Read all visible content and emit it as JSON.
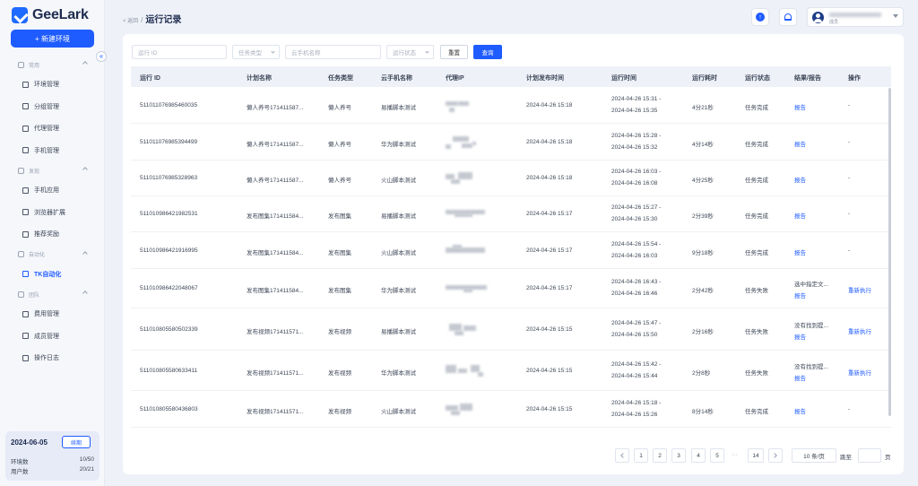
{
  "app": {
    "name": "GeeLark",
    "new_env_label": "+ 新建环境",
    "collapse_glyph": "«"
  },
  "sidebar": {
    "groups": [
      {
        "label": "常用",
        "items": [
          "环境管理",
          "分组管理",
          "代理管理",
          "手机管理"
        ]
      },
      {
        "label": "发现",
        "items": [
          "手机应用",
          "浏览器扩展",
          "推荐奖励"
        ]
      },
      {
        "label": "自动化",
        "items": [
          "TK自动化"
        ]
      },
      {
        "label": "团队",
        "items": [
          "费用管理",
          "成员管理",
          "操作日志"
        ]
      }
    ],
    "active_item": "TK自动化"
  },
  "subscription": {
    "date": "2024-06-05",
    "renew_label": "续期",
    "env_label": "环境数",
    "env_value": "10/50",
    "user_label": "用户数",
    "user_value": "20/21"
  },
  "header": {
    "back_label": "< 返回",
    "separator": "/",
    "title": "运行记录",
    "user_role": "成员"
  },
  "filters": {
    "run_id_placeholder": "运行 ID",
    "task_type_placeholder": "任务类型",
    "phone_name_placeholder": "云手机名称",
    "status_placeholder": "运行状态",
    "reset_label": "重置",
    "query_label": "查询"
  },
  "table": {
    "columns": [
      "运行 ID",
      "计划名称",
      "任务类型",
      "云手机名称",
      "代理IP",
      "计划发布时间",
      "运行时间",
      "运行耗时",
      "运行状态",
      "结果/报告",
      "操作"
    ],
    "rows": [
      {
        "id": "511011076985460035",
        "plan": "懒人养号171411587...",
        "type": "懒人养号",
        "phone": "易播脚本测试",
        "publish": "2024-04-26 15:18",
        "run_start": "2024-04-26 15:31 -",
        "run_end": "2024-04-26 15:35",
        "duration": "4分21秒",
        "status": "任务完成",
        "result": "",
        "report": "报告",
        "action": "-"
      },
      {
        "id": "511011076985394499",
        "plan": "懒人养号171411587...",
        "type": "懒人养号",
        "phone": "华为脚本测试",
        "publish": "2024-04-26 15:18",
        "run_start": "2024-04-26 15:28 -",
        "run_end": "2024-04-26 15:32",
        "duration": "4分14秒",
        "status": "任务完成",
        "result": "",
        "report": "报告",
        "action": "-"
      },
      {
        "id": "511011076985328963",
        "plan": "懒人养号171411587...",
        "type": "懒人养号",
        "phone": "火山脚本测试",
        "publish": "2024-04-26 15:18",
        "run_start": "2024-04-26 16:03 -",
        "run_end": "2024-04-26 16:08",
        "duration": "4分25秒",
        "status": "任务完成",
        "result": "",
        "report": "报告",
        "action": "-"
      },
      {
        "id": "511010986421982531",
        "plan": "发布图集171411584...",
        "type": "发布图集",
        "phone": "易播脚本测试",
        "publish": "2024-04-26 15:17",
        "run_start": "2024-04-26 15:27 -",
        "run_end": "2024-04-26 15:30",
        "duration": "2分39秒",
        "status": "任务完成",
        "result": "",
        "report": "报告",
        "action": "-"
      },
      {
        "id": "511010986421916995",
        "plan": "发布图集171411584...",
        "type": "发布图集",
        "phone": "火山脚本测试",
        "publish": "2024-04-26 15:17",
        "run_start": "2024-04-26 15:54 -",
        "run_end": "2024-04-26 16:03",
        "duration": "9分18秒",
        "status": "任务完成",
        "result": "",
        "report": "报告",
        "action": "-"
      },
      {
        "id": "511010986422048067",
        "plan": "发布图集171411584...",
        "type": "发布图集",
        "phone": "华为脚本测试",
        "publish": "2024-04-26 15:17",
        "run_start": "2024-04-26 16:43 -",
        "run_end": "2024-04-26 16:46",
        "duration": "2分42秒",
        "status": "任务失败",
        "result": "选中指定文...",
        "report": "报告",
        "action": "重新执行"
      },
      {
        "id": "511010805580502339",
        "plan": "发布视频171411571...",
        "type": "发布视频",
        "phone": "易播脚本测试",
        "publish": "2024-04-26 15:15",
        "run_start": "2024-04-26 15:47 -",
        "run_end": "2024-04-26 15:50",
        "duration": "2分16秒",
        "status": "任务失败",
        "result": "没有找到提...",
        "report": "报告",
        "action": "重新执行"
      },
      {
        "id": "511010805580633411",
        "plan": "发布视频171411571...",
        "type": "发布视频",
        "phone": "华为脚本测试",
        "publish": "2024-04-26 15:15",
        "run_start": "2024-04-26 15:42 -",
        "run_end": "2024-04-26 15:44",
        "duration": "2分8秒",
        "status": "任务失败",
        "result": "没有找到提...",
        "report": "报告",
        "action": "重新执行"
      },
      {
        "id": "511010805580436803",
        "plan": "发布视频171411571...",
        "type": "发布视频",
        "phone": "火山脚本测试",
        "publish": "2024-04-26 15:15",
        "run_start": "2024-04-26 15:18 -",
        "run_end": "2024-04-26 15:26",
        "duration": "8分14秒",
        "status": "任务完成",
        "result": "",
        "report": "报告",
        "action": "-"
      }
    ]
  },
  "pagination": {
    "pages": [
      "1",
      "2",
      "3",
      "4",
      "5"
    ],
    "ellipsis": "···",
    "last_page": "14",
    "page_size": "10 条/页",
    "jump_label": "跳至",
    "page_suffix": "页"
  },
  "colors": {
    "accent": "#1f5cff",
    "sidebar_bg": "#f5f7fb",
    "page_bg": "#eef1f7"
  }
}
